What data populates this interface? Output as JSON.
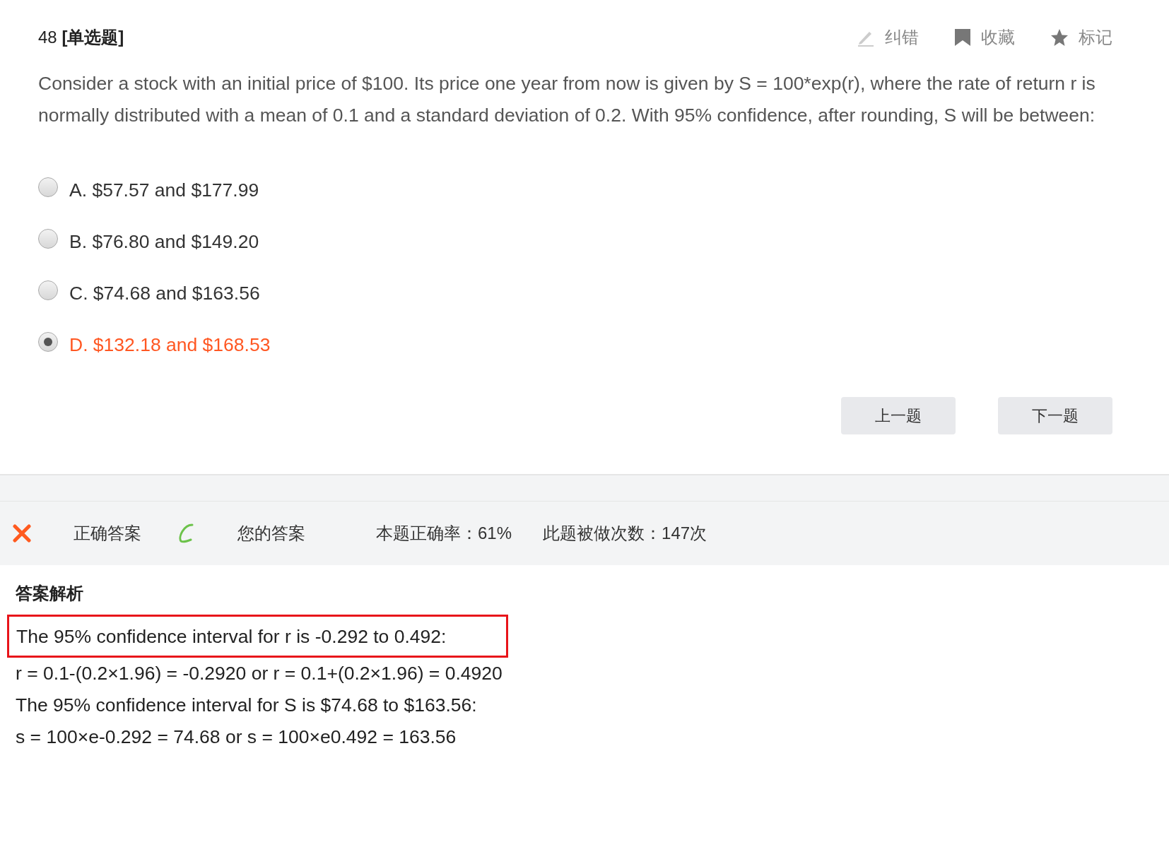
{
  "question": {
    "number": "48 **[单选题]**",
    "actions": [
      {
        "kind": "pencil",
        "label": "纠错"
      },
      {
        "kind": "bookmark",
        "label": "收藏"
      },
      {
        "kind": "star",
        "label": "标记"
      }
    ],
    "text": "Consider a stock with an initial price of $100. Its price one year from now is given by S = 100*exp(r), where the rate of return r is normally distributed with a mean of 0.1 and a standard deviation of 0.2. With 95% confidence, after rounding, S will be between:",
    "options": [
      {
        "label": "A. $57.57 and $177.99",
        "selected": false
      },
      {
        "label": "B. $76.80 and $149.20",
        "selected": false
      },
      {
        "label": "C. $74.68 and $163.56",
        "selected": false
      },
      {
        "label": "D. $132.18 and $168.53",
        "selected": true
      }
    ],
    "buttons": [
      "上一题",
      "下一题"
    ]
  },
  "result": {
    "items": [
      {
        "kind": "cross",
        "label": "正确答案"
      },
      {
        "kind": "check",
        "label": "您的答案"
      }
    ],
    "stats": [
      "本题正确率：61%",
      "此题被做次数：147次"
    ]
  },
  "analysis": {
    "title": "答案解析",
    "lines": [
      {
        "text": "The 95% confidence interval for r is -0.292 to 0.492:",
        "highlighted": true
      },
      {
        "text": "r = 0.1-(0.2×1.96) = -0.2920 or r = 0.1+(0.2×1.96) = 0.4920",
        "highlighted": false
      },
      {
        "text": "The 95% confidence interval for S is $74.68 to $163.56:",
        "highlighted": false
      },
      {
        "text": "s = 100×e-0.292 = 74.68 or s = 100×e0.492 = 163.56",
        "highlighted": false
      }
    ]
  }
}
